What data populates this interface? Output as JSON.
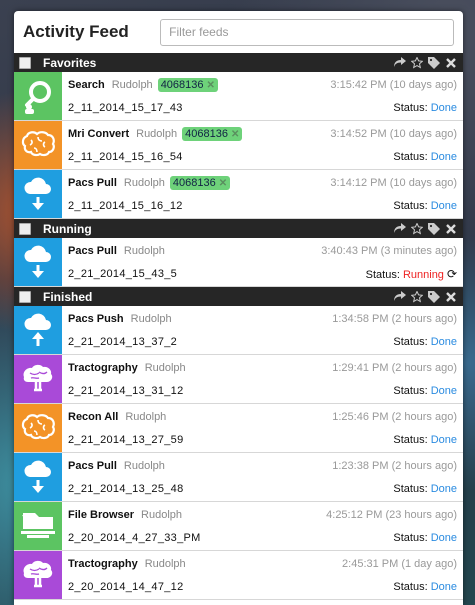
{
  "header": {
    "title": "Activity Feed",
    "filter_placeholder": "Filter feeds"
  },
  "sections": [
    {
      "key": "favorites",
      "label": "Favorites",
      "has_actions": true,
      "items": [
        {
          "name": "Search",
          "user": "Rudolph",
          "tag": "4068136",
          "time": "3:15:42 PM (10 days ago)",
          "dataset": "2_11_2014_15_17_43",
          "status": "Done",
          "icon": "search-icon",
          "color": "#5cc462"
        },
        {
          "name": "Mri Convert",
          "user": "Rudolph",
          "tag": "4068136",
          "time": "3:14:52 PM (10 days ago)",
          "dataset": "2_11_2014_15_16_54",
          "status": "Done",
          "icon": "brain-icon",
          "color": "#f39327"
        },
        {
          "name": "Pacs Pull",
          "user": "Rudolph",
          "tag": "4068136",
          "time": "3:14:12 PM (10 days ago)",
          "dataset": "2_11_2014_15_16_12",
          "status": "Done",
          "icon": "cloud-download-icon",
          "color": "#1f9ee0"
        }
      ]
    },
    {
      "key": "running",
      "label": "Running",
      "has_actions": true,
      "items": [
        {
          "name": "Pacs Pull",
          "user": "Rudolph",
          "tag": "",
          "time": "3:40:43 PM (3 minutes ago)",
          "dataset": "2_21_2014_15_43_5",
          "status": "Running",
          "icon": "cloud-download-icon",
          "color": "#1f9ee0"
        }
      ]
    },
    {
      "key": "finished",
      "label": "Finished",
      "has_actions": true,
      "items": [
        {
          "name": "Pacs Push",
          "user": "Rudolph",
          "tag": "",
          "time": "1:34:58 PM (2 hours ago)",
          "dataset": "2_21_2014_13_37_2",
          "status": "Done",
          "icon": "cloud-upload-icon",
          "color": "#1f9ee0"
        },
        {
          "name": "Tractography",
          "user": "Rudolph",
          "tag": "",
          "time": "1:29:41 PM (2 hours ago)",
          "dataset": "2_21_2014_13_31_12",
          "status": "Done",
          "icon": "tract-brain-icon",
          "color": "#a94ad8"
        },
        {
          "name": "Recon All",
          "user": "Rudolph",
          "tag": "",
          "time": "1:25:46 PM (2 hours ago)",
          "dataset": "2_21_2014_13_27_59",
          "status": "Done",
          "icon": "brain-icon",
          "color": "#f39327"
        },
        {
          "name": "Pacs Pull",
          "user": "Rudolph",
          "tag": "",
          "time": "1:23:38 PM (2 hours ago)",
          "dataset": "2_21_2014_13_25_48",
          "status": "Done",
          "icon": "cloud-download-icon",
          "color": "#1f9ee0"
        },
        {
          "name": "File Browser",
          "user": "Rudolph",
          "tag": "",
          "time": "4:25:12 PM (23 hours ago)",
          "dataset": "2_20_2014_4_27_33_PM",
          "status": "Done",
          "icon": "folder-icon",
          "color": "#5cc462"
        },
        {
          "name": "Tractography",
          "user": "Rudolph",
          "tag": "",
          "time": "2:45:31 PM (1 day ago)",
          "dataset": "2_20_2014_14_47_12",
          "status": "Done",
          "icon": "tract-brain-icon",
          "color": "#a94ad8"
        }
      ]
    }
  ],
  "status_label": "Status:"
}
